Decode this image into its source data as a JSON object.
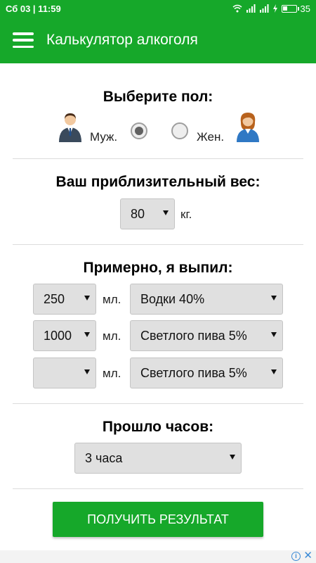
{
  "status_bar": {
    "time": "Сб 03 | 11:59",
    "battery": "35"
  },
  "app_bar": {
    "title": "Калькулятор алкоголя"
  },
  "gender": {
    "title": "Выберите пол:",
    "male_label": "Муж.",
    "female_label": "Жен.",
    "selected": "male"
  },
  "weight": {
    "title": "Ваш приблизительный вес:",
    "value": "80",
    "unit": "кг."
  },
  "drinks": {
    "title": "Примерно, я выпил:",
    "rows": [
      {
        "amount": "250",
        "unit": "мл.",
        "type": "Водки 40%"
      },
      {
        "amount": "1000",
        "unit": "мл.",
        "type": "Светлого пива 5%"
      },
      {
        "amount": "",
        "unit": "мл.",
        "type": "Светлого пива 5%"
      }
    ]
  },
  "hours": {
    "title": "Прошло часов:",
    "value": "3 часа"
  },
  "result_button": "ПОЛУЧИТЬ РЕЗУЛЬТАТ",
  "ad": {
    "info_icon": "i",
    "close_icon": "✕"
  },
  "colors": {
    "brand_green": "#16a82a"
  }
}
